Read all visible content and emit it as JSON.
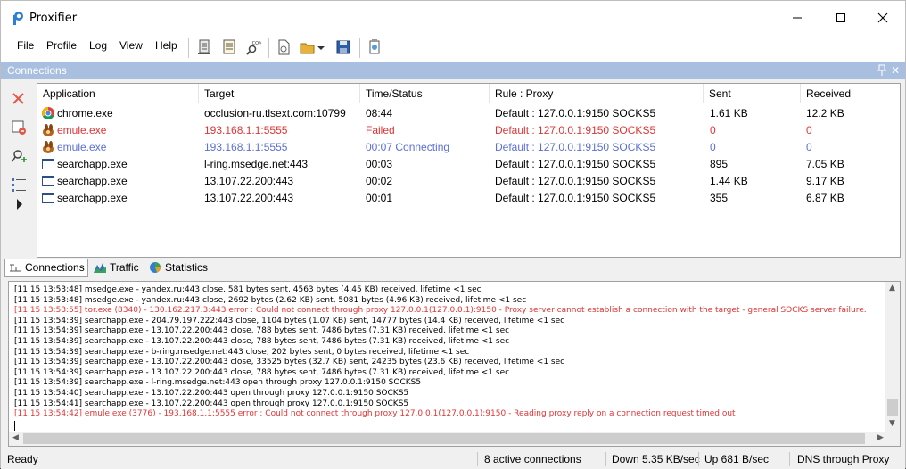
{
  "window": {
    "title": "Proxifier",
    "minimize": "—",
    "maximize": "☐",
    "close": "✕"
  },
  "menu": [
    "File",
    "Profile",
    "Log",
    "View",
    "Help"
  ],
  "toolbar_icons": [
    "log-view-icon",
    "log-file-icon",
    "dns-lookup-icon",
    "new-profile-icon",
    "open-profile-icon",
    "save-profile-icon",
    "settings-icon"
  ],
  "connections_panel": {
    "title": "Connections",
    "close": "✕"
  },
  "left_toolbar": [
    "close-connection-icon",
    "close-all-icon",
    "add-rule-icon",
    "columns-icon",
    "expand-icon"
  ],
  "table": {
    "headers": [
      "Application",
      "Target",
      "Time/Status",
      "Rule : Proxy",
      "Sent",
      "Received"
    ],
    "rows": [
      {
        "app": "chrome.exe",
        "icon": "chrome",
        "target": "occlusion-ru.tlsext.com:10799",
        "time": "08:44",
        "rule": "Default : 127.0.0.1:9150 SOCKS5",
        "sent": "1.61 KB",
        "received": "12.2 KB",
        "state": "normal"
      },
      {
        "app": "emule.exe",
        "icon": "emule",
        "target": "193.168.1.1:5555",
        "time": "Failed",
        "rule": "Default : 127.0.0.1:9150 SOCKS5",
        "sent": "0",
        "received": "0",
        "state": "failed"
      },
      {
        "app": "emule.exe",
        "icon": "emule",
        "target": "193.168.1.1:5555",
        "time": "00:07 Connecting",
        "rule": "Default : 127.0.0.1:9150 SOCKS5",
        "sent": "0",
        "received": "0",
        "state": "connecting"
      },
      {
        "app": "searchapp.exe",
        "icon": "window",
        "target": "l-ring.msedge.net:443",
        "time": "00:03",
        "rule": "Default : 127.0.0.1:9150 SOCKS5",
        "sent": "895",
        "received": "7.05 KB",
        "state": "normal"
      },
      {
        "app": "searchapp.exe",
        "icon": "window",
        "target": "13.107.22.200:443",
        "time": "00:02",
        "rule": "Default : 127.0.0.1:9150 SOCKS5",
        "sent": "1.44 KB",
        "received": "9.17 KB",
        "state": "normal"
      },
      {
        "app": "searchapp.exe",
        "icon": "window",
        "target": "13.107.22.200:443",
        "time": "00:01",
        "rule": "Default : 127.0.0.1:9150 SOCKS5",
        "sent": "355",
        "received": "6.87 KB",
        "state": "normal"
      }
    ]
  },
  "tabs": [
    {
      "label": "Connections",
      "icon": "connections-icon",
      "active": true
    },
    {
      "label": "Traffic",
      "icon": "traffic-icon",
      "active": false
    },
    {
      "label": "Statistics",
      "icon": "statistics-icon",
      "active": false
    }
  ],
  "log": [
    {
      "text": "[11.15 13:53:48] msedge.exe - yandex.ru:443 close, 581 bytes sent, 4563 bytes (4.45 KB) received, lifetime <1 sec",
      "error": false
    },
    {
      "text": "[11.15 13:53:48] msedge.exe - yandex.ru:443 close, 2692 bytes (2.62 KB) sent, 5081 bytes (4.96 KB) received, lifetime <1 sec",
      "error": false
    },
    {
      "text": "[11.15 13:53:55] tor.exe (8340) - 130.162.217.3:443 error : Could not connect through proxy 127.0.0.1(127.0.0.1):9150 - Proxy server cannot establish a connection with the target - general SOCKS server failure.",
      "error": true
    },
    {
      "text": "[11.15 13:54:39] searchapp.exe - 204.79.197.222:443 close, 1104 bytes (1.07 KB) sent, 14777 bytes (14.4 KB) received, lifetime <1 sec",
      "error": false
    },
    {
      "text": "[11.15 13:54:39] searchapp.exe - 13.107.22.200:443 close, 788 bytes sent, 7486 bytes (7.31 KB) received, lifetime <1 sec",
      "error": false
    },
    {
      "text": "[11.15 13:54:39] searchapp.exe - 13.107.22.200:443 close, 788 bytes sent, 7486 bytes (7.31 KB) received, lifetime <1 sec",
      "error": false
    },
    {
      "text": "[11.15 13:54:39] searchapp.exe - b-ring.msedge.net:443 close, 202 bytes sent, 0 bytes received, lifetime <1 sec",
      "error": false
    },
    {
      "text": "[11.15 13:54:39] searchapp.exe - 13.107.22.200:443 close, 33525 bytes (32.7 KB) sent, 24235 bytes (23.6 KB) received, lifetime <1 sec",
      "error": false
    },
    {
      "text": "[11.15 13:54:39] searchapp.exe - 13.107.22.200:443 close, 788 bytes sent, 7486 bytes (7.31 KB) received, lifetime <1 sec",
      "error": false
    },
    {
      "text": "[11.15 13:54:39] searchapp.exe - l-ring.msedge.net:443 open through proxy 127.0.0.1:9150 SOCKS5",
      "error": false
    },
    {
      "text": "[11.15 13:54:40] searchapp.exe - 13.107.22.200:443 open through proxy 127.0.0.1:9150 SOCKS5",
      "error": false
    },
    {
      "text": "[11.15 13:54:41] searchapp.exe - 13.107.22.200:443 open through proxy 127.0.0.1:9150 SOCKS5",
      "error": false
    },
    {
      "text": "[11.15 13:54:42] emule.exe (3776) - 193.168.1.1:5555 error : Could not connect through proxy 127.0.0.1(127.0.0.1):9150 - Reading proxy reply on a connection request timed out",
      "error": true
    }
  ],
  "status": {
    "ready": "Ready",
    "active": "8 active connections",
    "down": "Down 5.35 KB/sec",
    "up": "Up 681 B/sec",
    "dns": "DNS through Proxy"
  },
  "colors": {
    "error": "#e03535",
    "connecting": "#5b6fd6",
    "panel_header": "#a9bfe0"
  }
}
